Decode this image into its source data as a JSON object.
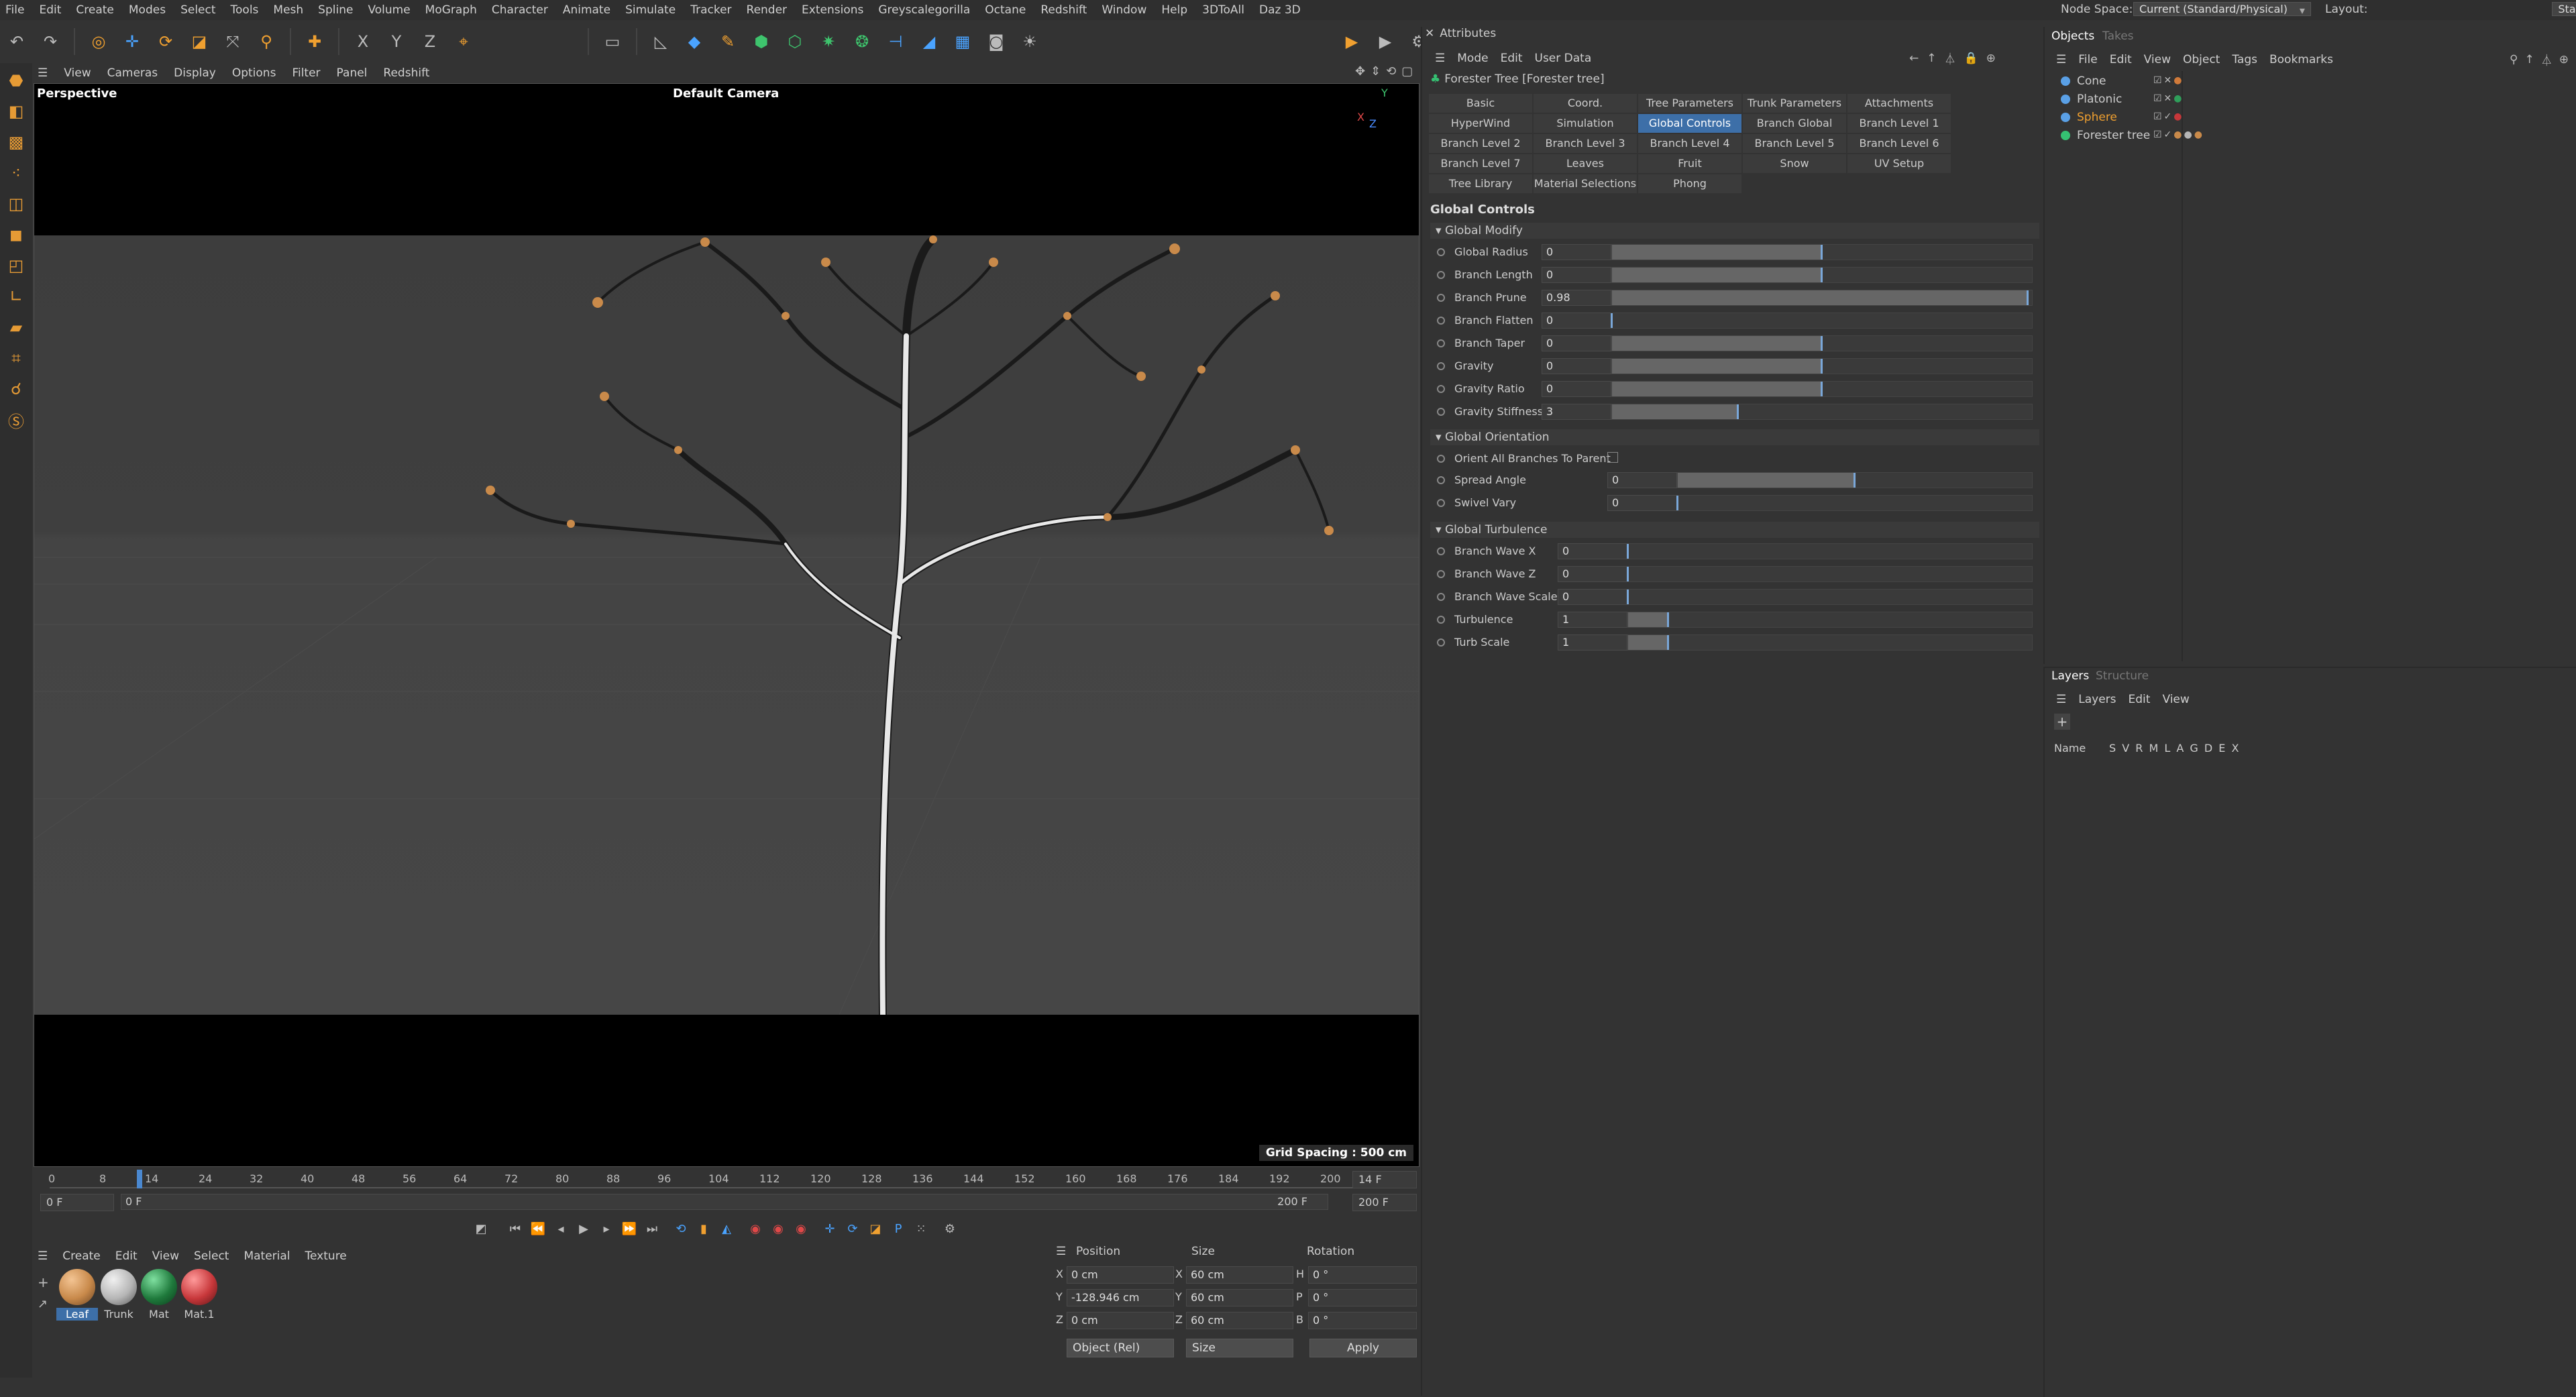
{
  "menubar": {
    "items": [
      "File",
      "Edit",
      "Create",
      "Modes",
      "Select",
      "Tools",
      "Mesh",
      "Spline",
      "Volume",
      "MoGraph",
      "Character",
      "Animate",
      "Simulate",
      "Tracker",
      "Render",
      "Extensions",
      "Greyscalegorilla",
      "Octane",
      "Redshift",
      "Window",
      "Help",
      "3DToAll",
      "Daz 3D"
    ],
    "node_space_label": "Node Space:",
    "node_space_value": "Current (Standard/Physical)",
    "layout_label": "Layout:",
    "layout_value": "Startup (User)"
  },
  "viewport": {
    "menu": [
      "View",
      "Cameras",
      "Display",
      "Options",
      "Filter",
      "Panel",
      "Redshift"
    ],
    "view_name": "Perspective",
    "camera": "Default Camera",
    "camera_icon": "camera-dot-icon",
    "grid_spacing": "Grid Spacing : 500 cm",
    "axis_labels": {
      "y": "Y",
      "x": "X",
      "z": "Z"
    }
  },
  "timeline": {
    "ticks": [
      "0",
      "8",
      "14",
      "24",
      "32",
      "40",
      "48",
      "56",
      "64",
      "72",
      "80",
      "88",
      "96",
      "104",
      "112",
      "120",
      "128",
      "136",
      "144",
      "152",
      "160",
      "168",
      "176",
      "184",
      "192",
      "200"
    ],
    "current_frame_marker": "14",
    "current_frame_box": "14 F",
    "start_frame": "0 F",
    "range_start": "0 F",
    "range_end": "200 F",
    "end_frame": "200 F"
  },
  "material_manager": {
    "menu": [
      "Create",
      "Edit",
      "View",
      "Select",
      "Material",
      "Texture"
    ],
    "materials": [
      {
        "name": "Leaf",
        "color": "#c8894a",
        "selected": true
      },
      {
        "name": "Trunk",
        "color": "#b5b5b5",
        "selected": false
      },
      {
        "name": "Mat",
        "color": "#1f7a3c",
        "selected": false
      },
      {
        "name": "Mat.1",
        "color": "#c7373a",
        "selected": false
      }
    ]
  },
  "coordinates": {
    "headers": {
      "position": "Position",
      "size": "Size",
      "rotation": "Rotation"
    },
    "rows": [
      {
        "pos_axis": "X",
        "pos": "0 cm",
        "size_axis": "X",
        "size": "60 cm",
        "rot_axis": "H",
        "rot": "0 °"
      },
      {
        "pos_axis": "Y",
        "pos": "-128.946 cm",
        "size_axis": "Y",
        "size": "60 cm",
        "rot_axis": "P",
        "rot": "0 °"
      },
      {
        "pos_axis": "Z",
        "pos": "0 cm",
        "size_axis": "Z",
        "size": "60 cm",
        "rot_axis": "B",
        "rot": "0 °"
      }
    ],
    "mode_select": "Object (Rel)",
    "size_select": "Size",
    "apply": "Apply"
  },
  "attributes": {
    "title": "Attributes",
    "menu": [
      "Mode",
      "Edit",
      "User Data"
    ],
    "object": "Forester Tree [Forester tree]",
    "tabs": [
      [
        "Basic",
        "Coord.",
        "Tree Parameters",
        "Trunk Parameters",
        "Attachments"
      ],
      [
        "HyperWind",
        "Simulation",
        "Global Controls",
        "Branch Global",
        "Branch Level 1"
      ],
      [
        "Branch Level 2",
        "Branch Level 3",
        "Branch Level 4",
        "Branch Level 5",
        "Branch Level 6"
      ],
      [
        "Branch Level 7",
        "Leaves",
        "Fruit",
        "Snow",
        "UV Setup"
      ],
      [
        "Tree Library",
        "Material Selections",
        "Phong"
      ]
    ],
    "active_tab": "Global Controls",
    "section": "Global Controls",
    "global_modify": {
      "title": "Global Modify",
      "params": [
        {
          "label": "Global Radius",
          "value": "0",
          "level": 0.5
        },
        {
          "label": "Branch Length",
          "value": "0",
          "level": 0.5
        },
        {
          "label": "Branch Prune",
          "value": "0.98",
          "level": 0.99
        },
        {
          "label": "Branch Flatten",
          "value": "0",
          "level": 0.0
        },
        {
          "label": "Branch Taper",
          "value": "0",
          "level": 0.5
        },
        {
          "label": "Gravity",
          "value": "0",
          "level": 0.5
        },
        {
          "label": "Gravity Ratio",
          "value": "0",
          "level": 0.5
        },
        {
          "label": "Gravity Stiffness",
          "value": "3",
          "level": 0.3
        }
      ]
    },
    "global_orientation": {
      "title": "Global Orientation",
      "orient_label": "Orient All Branches To Parent",
      "params": [
        {
          "label": "Spread Angle",
          "value": "0",
          "level": 0.5
        },
        {
          "label": "Swivel Vary",
          "value": "0",
          "level": 0.0
        }
      ]
    },
    "global_turbulence": {
      "title": "Global Turbulence",
      "params": [
        {
          "label": "Branch Wave X",
          "value": "0",
          "level": 0.0
        },
        {
          "label": "Branch Wave Z",
          "value": "0",
          "level": 0.0
        },
        {
          "label": "Branch Wave Scale",
          "value": "0",
          "level": 0.0
        },
        {
          "label": "Turbulence",
          "value": "1",
          "level": 0.1
        },
        {
          "label": "Turb Scale",
          "value": "1",
          "level": 0.1
        }
      ]
    }
  },
  "objects_panel": {
    "tabs": [
      "Objects",
      "Takes"
    ],
    "menu": [
      "File",
      "Edit",
      "View",
      "Object",
      "Tags",
      "Bookmarks"
    ],
    "items": [
      {
        "name": "Cone",
        "icon_color": "#5aa0e6",
        "selected": false
      },
      {
        "name": "Platonic",
        "icon_color": "#5aa0e6",
        "selected": false
      },
      {
        "name": "Sphere",
        "icon_color": "#5aa0e6",
        "selected": true
      },
      {
        "name": "Forester tree",
        "icon_color": "#35c072",
        "selected": false
      }
    ]
  },
  "layers_panel": {
    "tabs": [
      "Layers",
      "Structure"
    ],
    "menu": [
      "Layers",
      "Edit",
      "View"
    ],
    "name_header": "Name",
    "columns": "S V R M L A G D E X"
  },
  "colors": {
    "accent": "#3d6fa8",
    "selected_object": "#f0a030"
  }
}
